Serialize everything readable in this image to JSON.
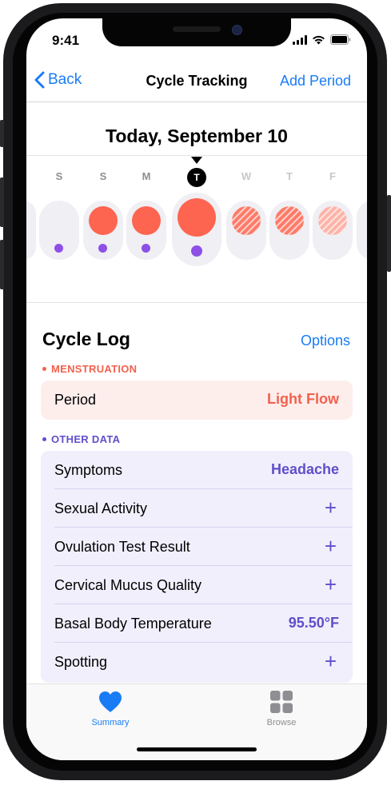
{
  "status_bar": {
    "time": "9:41"
  },
  "navbar": {
    "back_label": "Back",
    "title": "Cycle Tracking",
    "action_label": "Add Period"
  },
  "calendar": {
    "heading": "Today, September 10",
    "day_letters": [
      "S",
      "S",
      "M",
      "T",
      "W",
      "T",
      "F"
    ],
    "period_color": "#fe6550",
    "predicted_color": "#fe6550",
    "dot_color": "#8d4fe6"
  },
  "cycle_log": {
    "title": "Cycle Log",
    "options_label": "Options",
    "menstruation": {
      "label": "MENSTRUATION",
      "color": "#f2614e",
      "row_label": "Period",
      "row_value": "Light Flow"
    },
    "other_data": {
      "label": "OTHER DATA",
      "color": "#5f4fc9",
      "rows": [
        {
          "label": "Symptoms",
          "value": "Headache"
        },
        {
          "label": "Sexual Activity",
          "value": "+"
        },
        {
          "label": "Ovulation Test Result",
          "value": "+"
        },
        {
          "label": "Cervical Mucus Quality",
          "value": "+"
        },
        {
          "label": "Basal Body Temperature",
          "value": "95.50°F"
        },
        {
          "label": "Spotting",
          "value": "+"
        }
      ]
    }
  },
  "tabbar": {
    "items": [
      {
        "label": "Summary",
        "icon": "heart-icon",
        "active": true
      },
      {
        "label": "Browse",
        "icon": "grid-icon",
        "active": false
      }
    ],
    "active_color": "#1a7cf5",
    "inactive_color": "#8e8e93"
  }
}
